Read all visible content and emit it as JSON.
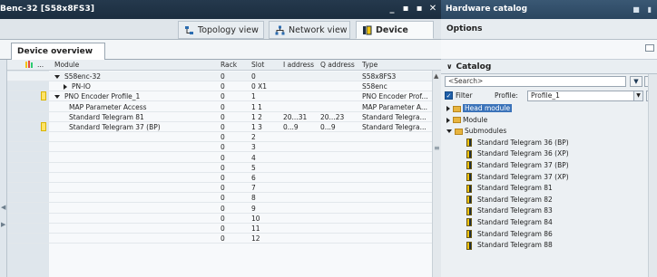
{
  "left_window": {
    "title": "Benc-32 [S58x8FS3]",
    "controls": [
      "_",
      "▪",
      "▪",
      "✕"
    ],
    "view_tabs": [
      {
        "label": "Topology view",
        "icon": "topology-icon"
      },
      {
        "label": "Network view",
        "icon": "network-icon"
      },
      {
        "label": "Device view",
        "icon": "device-icon"
      }
    ],
    "overview_tab": "Device overview",
    "table": {
      "columns": [
        "Module",
        "Rack",
        "Slot",
        "I address",
        "Q address",
        "Type"
      ],
      "rows": [
        {
          "module": "S58enc-32",
          "expander": "down",
          "indent": 0,
          "rack": "0",
          "slot": "0",
          "i": "",
          "q": "",
          "type": "S58x8FS3",
          "flag": false
        },
        {
          "module": "PN-IO",
          "expander": "right",
          "indent": 1,
          "rack": "0",
          "slot": "0 X1",
          "i": "",
          "q": "",
          "type": "S58enc",
          "flag": false
        },
        {
          "module": "PNO Encoder Profile_1",
          "expander": "down",
          "indent": 0,
          "rack": "0",
          "slot": "1",
          "i": "",
          "q": "",
          "type": "PNO Encoder Prof...",
          "flag": true
        },
        {
          "module": "MAP Parameter Access",
          "expander": "",
          "indent": 1,
          "rack": "0",
          "slot": "1 1",
          "i": "",
          "q": "",
          "type": "MAP Parameter A...",
          "flag": false
        },
        {
          "module": "Standard Telegram 81",
          "expander": "",
          "indent": 1,
          "rack": "0",
          "slot": "1 2",
          "i": "20...31",
          "q": "20...23",
          "type": "Standard Telegra...",
          "flag": false
        },
        {
          "module": "Standard Telegram 37 (BP)",
          "expander": "",
          "indent": 1,
          "rack": "0",
          "slot": "1 3",
          "i": "0...9",
          "q": "0...9",
          "type": "Standard Telegra...",
          "flag": true
        },
        {
          "module": "",
          "expander": "",
          "indent": 0,
          "rack": "0",
          "slot": "2",
          "i": "",
          "q": "",
          "type": "",
          "flag": false
        },
        {
          "module": "",
          "expander": "",
          "indent": 0,
          "rack": "0",
          "slot": "3",
          "i": "",
          "q": "",
          "type": "",
          "flag": false
        },
        {
          "module": "",
          "expander": "",
          "indent": 0,
          "rack": "0",
          "slot": "4",
          "i": "",
          "q": "",
          "type": "",
          "flag": false
        },
        {
          "module": "",
          "expander": "",
          "indent": 0,
          "rack": "0",
          "slot": "5",
          "i": "",
          "q": "",
          "type": "",
          "flag": false
        },
        {
          "module": "",
          "expander": "",
          "indent": 0,
          "rack": "0",
          "slot": "6",
          "i": "",
          "q": "",
          "type": "",
          "flag": false
        },
        {
          "module": "",
          "expander": "",
          "indent": 0,
          "rack": "0",
          "slot": "7",
          "i": "",
          "q": "",
          "type": "",
          "flag": false
        },
        {
          "module": "",
          "expander": "",
          "indent": 0,
          "rack": "0",
          "slot": "8",
          "i": "",
          "q": "",
          "type": "",
          "flag": false
        },
        {
          "module": "",
          "expander": "",
          "indent": 0,
          "rack": "0",
          "slot": "9",
          "i": "",
          "q": "",
          "type": "",
          "flag": false
        },
        {
          "module": "",
          "expander": "",
          "indent": 0,
          "rack": "0",
          "slot": "10",
          "i": "",
          "q": "",
          "type": "",
          "flag": false
        },
        {
          "module": "",
          "expander": "",
          "indent": 0,
          "rack": "0",
          "slot": "11",
          "i": "",
          "q": "",
          "type": "",
          "flag": false
        },
        {
          "module": "",
          "expander": "",
          "indent": 0,
          "rack": "0",
          "slot": "12",
          "i": "",
          "q": "",
          "type": "",
          "flag": false
        }
      ]
    }
  },
  "right_window": {
    "title": "Hardware catalog",
    "options_label": "Options",
    "catalog_label": "Catalog",
    "search_placeholder": "<Search>",
    "filter_label": "Filter",
    "profile_label": "Profile:",
    "profile_value": "Profile_1",
    "tree": [
      {
        "label": "Head module",
        "level": 0,
        "expander": "right",
        "selected": true,
        "kind": "folder"
      },
      {
        "label": "Module",
        "level": 0,
        "expander": "right",
        "selected": false,
        "kind": "folder"
      },
      {
        "label": "Submodules",
        "level": 0,
        "expander": "down",
        "selected": false,
        "kind": "folder"
      },
      {
        "label": "Standard Telegram 36 (BP)",
        "level": 1,
        "expander": "",
        "selected": false,
        "kind": "submodule"
      },
      {
        "label": "Standard Telegram 36 (XP)",
        "level": 1,
        "expander": "",
        "selected": false,
        "kind": "submodule"
      },
      {
        "label": "Standard Telegram 37 (BP)",
        "level": 1,
        "expander": "",
        "selected": false,
        "kind": "submodule"
      },
      {
        "label": "Standard Telegram 37 (XP)",
        "level": 1,
        "expander": "",
        "selected": false,
        "kind": "submodule"
      },
      {
        "label": "Standard Telegram 81",
        "level": 1,
        "expander": "",
        "selected": false,
        "kind": "submodule"
      },
      {
        "label": "Standard Telegram 82",
        "level": 1,
        "expander": "",
        "selected": false,
        "kind": "submodule"
      },
      {
        "label": "Standard Telegram 83",
        "level": 1,
        "expander": "",
        "selected": false,
        "kind": "submodule"
      },
      {
        "label": "Standard Telegram 84",
        "level": 1,
        "expander": "",
        "selected": false,
        "kind": "submodule"
      },
      {
        "label": "Standard Telegram 86",
        "level": 1,
        "expander": "",
        "selected": false,
        "kind": "submodule"
      },
      {
        "label": "Standard Telegram 88",
        "level": 1,
        "expander": "",
        "selected": false,
        "kind": "submodule"
      }
    ]
  },
  "colors": {
    "title_bar": "#1b2d3f",
    "catalog_title": "#2b4660",
    "selection": "#3b73b9",
    "module_flag": "#ffe36a"
  }
}
